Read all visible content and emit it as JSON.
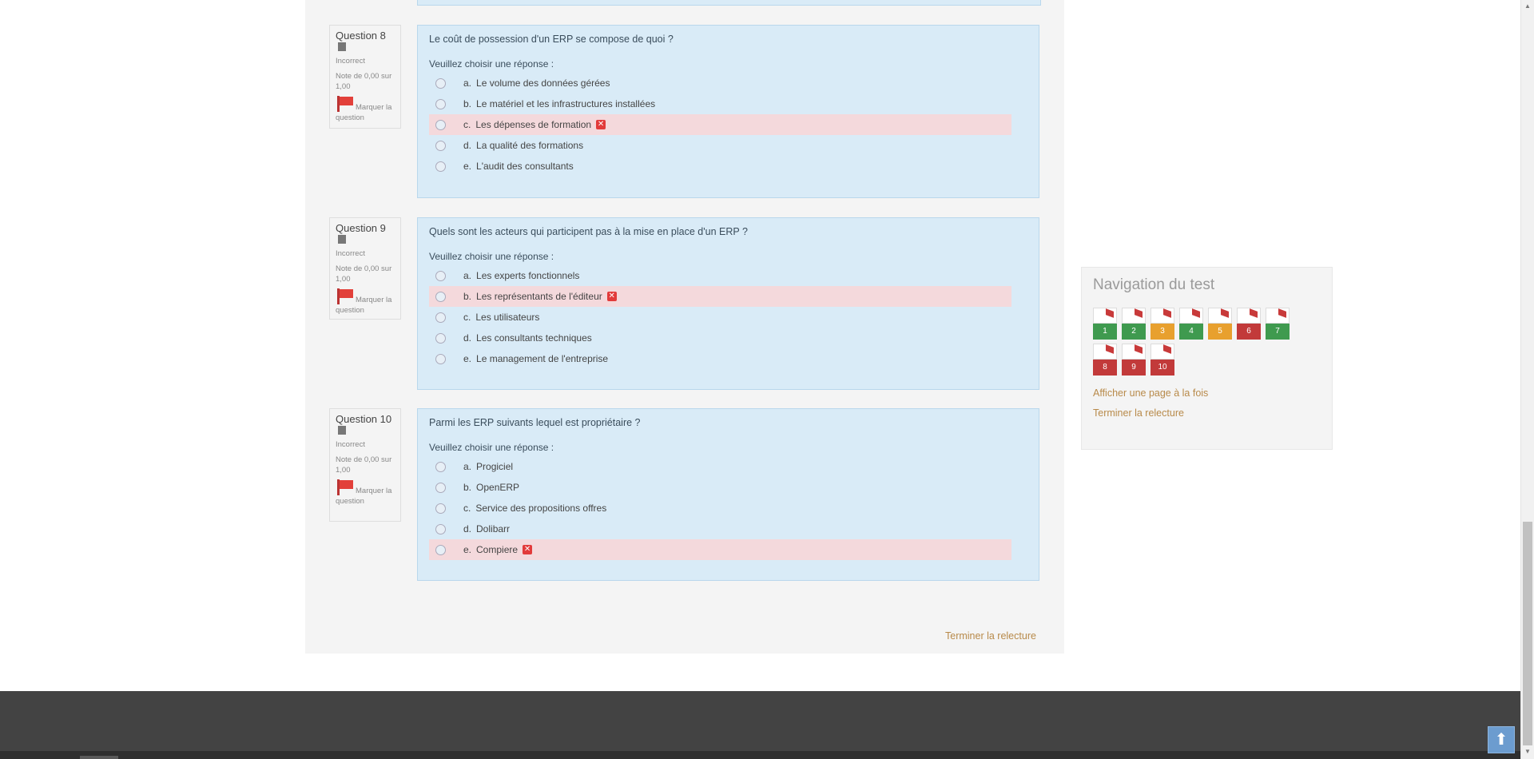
{
  "questions": [
    {
      "qno": "Question 8",
      "status": "Incorrect",
      "grade": "Note de 0,00 sur 1,00",
      "flag_label_1": "Marquer la",
      "flag_label_2": "question",
      "text": "Le coût de possession d'un ERP se compose de quoi ?",
      "prompt": "Veuillez choisir une réponse :",
      "answers": [
        {
          "letter": "a.",
          "text": "Le volume des données gérées"
        },
        {
          "letter": "b.",
          "text": "Le matériel et les infrastructures installées"
        },
        {
          "letter": "c.",
          "text": "Les dépenses de formation"
        },
        {
          "letter": "d.",
          "text": "La qualité des formations"
        },
        {
          "letter": "e.",
          "text": "L'audit des consultants"
        }
      ]
    },
    {
      "qno": "Question 9",
      "status": "Incorrect",
      "grade": "Note de 0,00 sur 1,00",
      "flag_label_1": "Marquer la",
      "flag_label_2": "question",
      "text": "Quels sont les acteurs qui participent pas à la mise en place d'un ERP ?",
      "prompt": "Veuillez choisir une réponse :",
      "answers": [
        {
          "letter": "a.",
          "text": "Les experts fonctionnels"
        },
        {
          "letter": "b.",
          "text": "Les représentants de l'éditeur"
        },
        {
          "letter": "c.",
          "text": "Les utilisateurs"
        },
        {
          "letter": "d.",
          "text": "Les consultants techniques"
        },
        {
          "letter": "e.",
          "text": "Le management de l'entreprise"
        }
      ]
    },
    {
      "qno": "Question 10",
      "status": "Incorrect",
      "grade": "Note de 0,00 sur 1,00",
      "flag_label_1": "Marquer la",
      "flag_label_2": "question",
      "text": "Parmi les ERP suivants lequel est propriétaire ?",
      "prompt": "Veuillez choisir une réponse :",
      "answers": [
        {
          "letter": "a.",
          "text": "Progiciel"
        },
        {
          "letter": "b.",
          "text": "OpenERP"
        },
        {
          "letter": "c.",
          "text": "Service des propositions offres"
        },
        {
          "letter": "d.",
          "text": "Dolibarr"
        },
        {
          "letter": "e.",
          "text": "Compiere"
        }
      ]
    }
  ],
  "finish_link": "Terminer la relecture",
  "nav": {
    "title": "Navigation du test",
    "buttons": [
      {
        "label": "1",
        "state": "correct"
      },
      {
        "label": "2",
        "state": "correct"
      },
      {
        "label": "3",
        "state": "partial"
      },
      {
        "label": "4",
        "state": "correct"
      },
      {
        "label": "5",
        "state": "partial"
      },
      {
        "label": "6",
        "state": "incorrect"
      },
      {
        "label": "7",
        "state": "correct"
      },
      {
        "label": "8",
        "state": "incorrect"
      },
      {
        "label": "9",
        "state": "incorrect"
      },
      {
        "label": "10",
        "state": "incorrect"
      }
    ],
    "link_one_page": "Afficher une page à la fois",
    "link_finish": "Terminer la relecture"
  },
  "back_to_top": "⬆",
  "colors": {
    "correct": "#3f9a4f",
    "partial": "#e8a02e",
    "incorrect": "#c23a3a",
    "question_bg": "#d9ebf7",
    "wrong_bg": "#f4d9dc"
  }
}
